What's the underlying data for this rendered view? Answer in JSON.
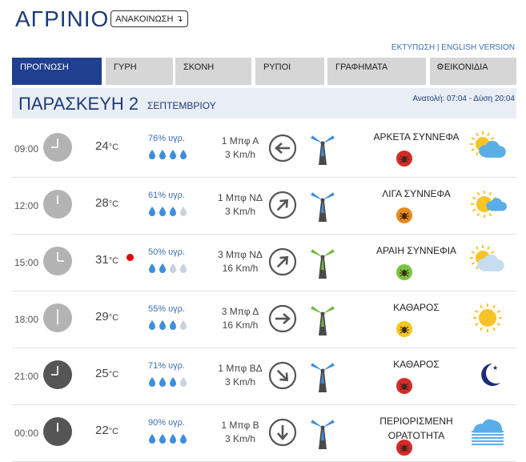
{
  "header": {
    "city": "ΑΓΡΙΝΙΟ",
    "announce_label": "ΑΝΑΚΟΙΝΩΣΗ",
    "print_link": "ΕΚΤΥΠΩΣΗ",
    "separator": "|",
    "english_link": "ENGLISH VERSION"
  },
  "tabs": [
    "ΠΡΟΓΝΩΣΗ",
    "ΓΥΡΗ",
    "ΣΚΟΝΗ",
    "ΡΥΠΟΙ",
    "ΓΡΑΦΗΜΑΤΑ",
    "ΕΙΚΟΝΙΔΙΑ"
  ],
  "day": {
    "name": "ΠΑΡΑΣΚΕΥΗ 2",
    "month": "ΣΕΠΤΕΜΒΡΙΟΥ",
    "sun": "Ανατολή: 07:04 - Δύση 20:04"
  },
  "temp_unit": "°C",
  "rows": [
    {
      "time": "09:00",
      "hour": 9,
      "night": false,
      "temp": "24",
      "hot": false,
      "humidity": "76% υγρ.",
      "drops": 4,
      "wind_bf": "1 Μπφ Α",
      "wind_kmh": "3 Km/h",
      "wind_dir": "left-arrow-icon",
      "turbine": "blue",
      "condition": "ΑΡΚΕΤΑ ΣΥΝΝΕΦΑ",
      "badge": "red",
      "icon": "sun-cloudy-icon"
    },
    {
      "time": "12:00",
      "hour": 12,
      "night": false,
      "temp": "28",
      "hot": false,
      "humidity": "61% υγρ.",
      "drops": 3,
      "wind_bf": "1 Μπφ ΝΔ",
      "wind_kmh": "3 Km/h",
      "wind_dir": "up-right-arrow-icon",
      "turbine": "blue",
      "condition": "ΛΙΓΑ ΣΥΝΝΕΦΑ",
      "badge": "orange",
      "icon": "sun-small-cloud-icon"
    },
    {
      "time": "15:00",
      "hour": 3,
      "night": false,
      "temp": "31",
      "hot": true,
      "humidity": "50% υγρ.",
      "drops": 2,
      "wind_bf": "3 Μπφ ΝΔ",
      "wind_kmh": "16 Km/h",
      "wind_dir": "up-right-arrow-icon",
      "turbine": "green",
      "condition": "ΑΡΑΙΗ ΣΥΝΝΕΦΙΑ",
      "badge": "green",
      "icon": "sun-pale-cloud-icon"
    },
    {
      "time": "18:00",
      "hour": 6,
      "night": false,
      "temp": "29",
      "hot": false,
      "humidity": "55% υγρ.",
      "drops": 3,
      "wind_bf": "3 Μπφ Δ",
      "wind_kmh": "16 Km/h",
      "wind_dir": "right-arrow-icon",
      "turbine": "green",
      "condition": "ΚΑΘΑΡΟΣ",
      "badge": "yellow",
      "icon": "sun-icon"
    },
    {
      "time": "21:00",
      "hour": 9,
      "night": true,
      "temp": "25",
      "hot": false,
      "humidity": "71% υγρ.",
      "drops": 3,
      "wind_bf": "1 Μπφ ΒΔ",
      "wind_kmh": "3 Km/h",
      "wind_dir": "down-right-arrow-icon",
      "turbine": "blue",
      "condition": "ΚΑΘΑΡΟΣ",
      "badge": "red",
      "icon": "moon-icon"
    },
    {
      "time": "00:00",
      "hour": 12,
      "night": true,
      "temp": "22",
      "hot": false,
      "humidity": "90% υγρ.",
      "drops": 4,
      "wind_bf": "1 Μπφ Β",
      "wind_kmh": "3 Km/h",
      "wind_dir": "down-arrow-icon",
      "turbine": "blue",
      "condition": "ΠΕΡΙΟΡΙΣΜΕΝΗ ΟΡΑΤΟΤΗΤΑ",
      "condition_lines": [
        "ΠΕΡΙΟΡΙΣΜΕΝΗ",
        "ΟΡΑΤΟΤΗΤΑ"
      ],
      "badge": "red",
      "icon": "fog-icon"
    }
  ],
  "colors": {
    "brand": "#1d3b7a",
    "tab_active": "#1f3f8f",
    "tab": "#d6d6d6",
    "day_clock": "#b3b3b3",
    "night_clock": "#555555",
    "drop_on": "#3e8edd",
    "drop_off": "#c9d3dd",
    "badge_red": "#d52a2a",
    "badge_orange": "#e7891d",
    "badge_green": "#7cc242",
    "badge_yellow": "#f2c81d",
    "turbine_blue": "#3e8edd",
    "turbine_green": "#6cba3a",
    "sun": "#f7c428",
    "cloud": "#5aaee8"
  }
}
